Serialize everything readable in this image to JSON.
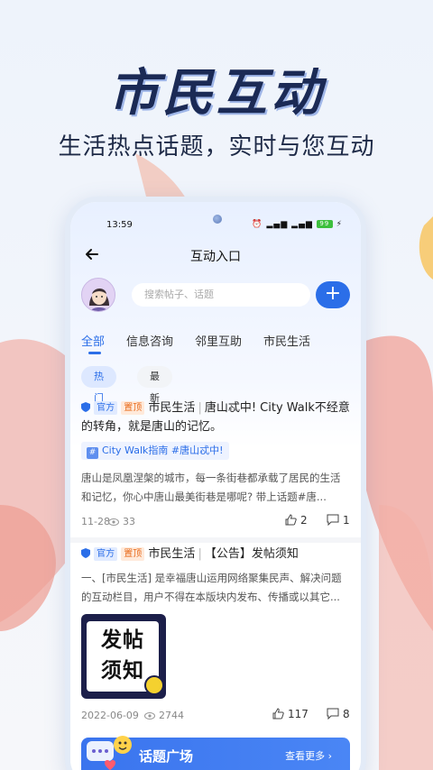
{
  "hero": {
    "title": "市民互动",
    "subtitle": "生活热点话题，实时与您互动"
  },
  "status_bar": {
    "time": "13:59",
    "battery": "99"
  },
  "header": {
    "title": "互动入口"
  },
  "search": {
    "placeholder": "搜索帖子、话题"
  },
  "tabs": [
    {
      "label": "全部",
      "active": true
    },
    {
      "label": "信息咨询",
      "active": false
    },
    {
      "label": "邻里互助",
      "active": false
    },
    {
      "label": "市民生活",
      "active": false
    }
  ],
  "filters": [
    {
      "label": "热门",
      "active": true
    },
    {
      "label": "最新",
      "active": false
    }
  ],
  "posts": [
    {
      "badge_official": "官方",
      "badge_top": "置顶",
      "category": "市民生活",
      "title": "唐山忒中! City Walk不经意的转角，就是唐山的记忆。",
      "tag": "City Walk指南 #唐山忒中!",
      "excerpt": "唐山是凤凰涅槃的城市，每一条街巷都承载了居民的生活和记忆，你心中唐山最美街巷是哪呢? 带上话题#唐...",
      "date": "11-28",
      "views": "33",
      "likes": "2",
      "comments": "1"
    },
    {
      "badge_official": "官方",
      "badge_top": "置顶",
      "category": "市民生活",
      "title": "【公告】发帖须知",
      "excerpt": "一、[市民生活] 是幸福唐山运用网络聚集民声、解决问题的互动栏目，用户不得在本版块内发布、传播或以其它...",
      "image_text": "发帖须知",
      "date": "2022-06-09",
      "views": "2744",
      "likes": "117",
      "comments": "8"
    }
  ],
  "topic_square": {
    "title": "话题广场",
    "more": "查看更多"
  },
  "colors": {
    "accent": "#2b6ee8",
    "hero_title": "#1b2a55"
  }
}
